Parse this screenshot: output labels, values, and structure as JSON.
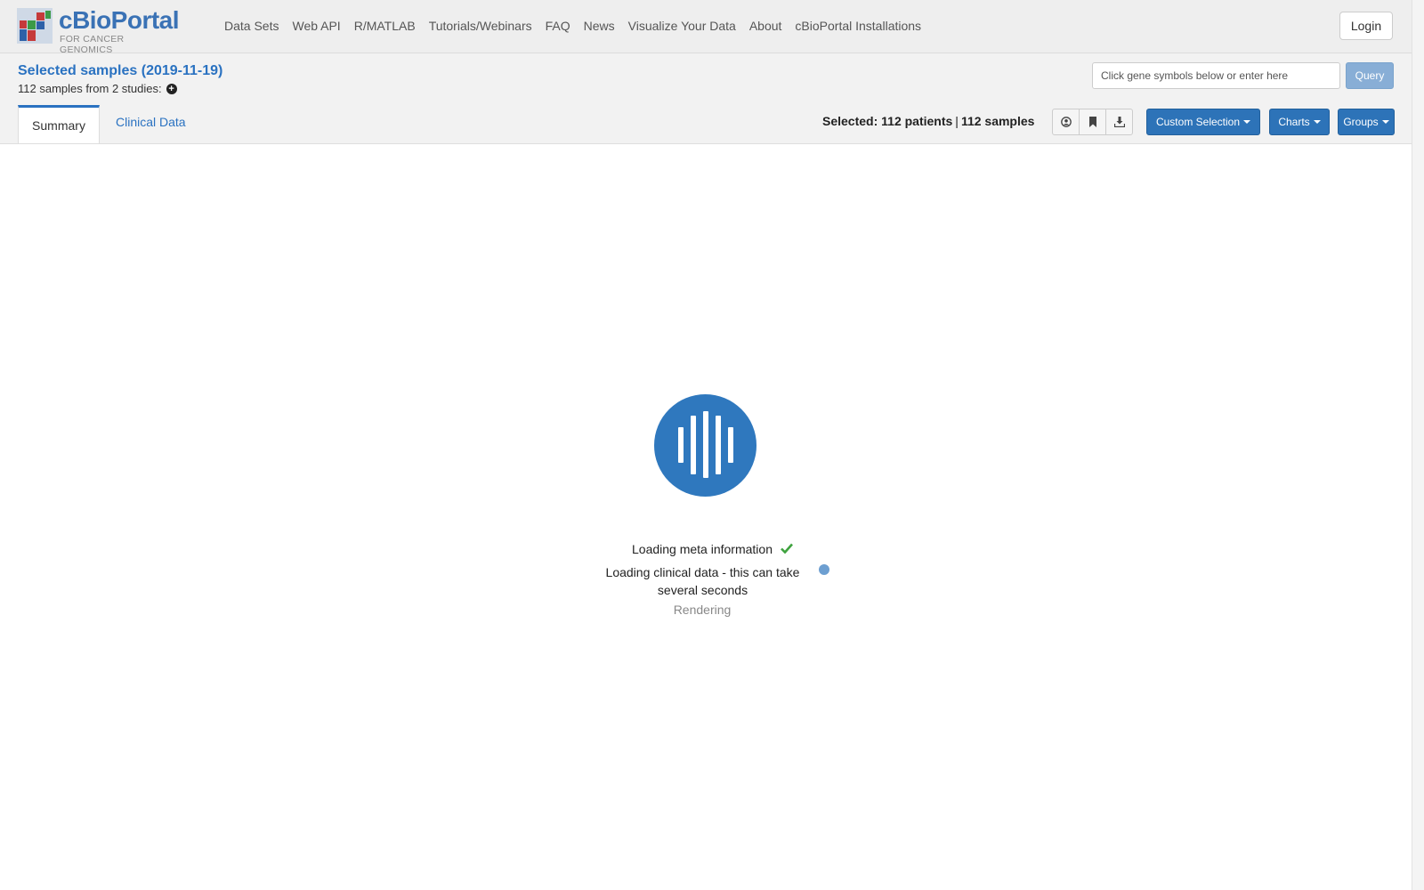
{
  "brand": {
    "name": "cBioPortal",
    "tagline": "FOR CANCER GENOMICS"
  },
  "nav": {
    "links": [
      "Data Sets",
      "Web API",
      "R/MATLAB",
      "Tutorials/Webinars",
      "FAQ",
      "News",
      "Visualize Your Data",
      "About",
      "cBioPortal Installations"
    ],
    "login_label": "Login"
  },
  "header": {
    "title": "Selected samples (2019-11-19)",
    "subtitle": "112 samples from 2 studies:",
    "gene_input_placeholder": "Click gene symbols below or enter here",
    "query_label": "Query"
  },
  "tabs": {
    "summary": "Summary",
    "clinical": "Clinical Data"
  },
  "selection": {
    "prefix": "Selected:",
    "patients": "112 patients",
    "separator": "|",
    "samples": "112 samples"
  },
  "toolbar": {
    "icons": [
      "user-circle-icon",
      "bookmark-icon",
      "download-icon"
    ],
    "custom_selection_label": "Custom Selection",
    "charts_label": "Charts",
    "groups_label": "Groups"
  },
  "loading": {
    "steps": [
      {
        "text": "Loading meta information",
        "status": "done"
      },
      {
        "text": "Loading clinical data - this can take several seconds",
        "status": "in-progress"
      },
      {
        "text": "Rendering",
        "status": "pending"
      }
    ]
  },
  "colors": {
    "accent": "#2d73b8",
    "link": "#2a72c1",
    "success": "#3fa33f",
    "pending_text": "#888888"
  }
}
